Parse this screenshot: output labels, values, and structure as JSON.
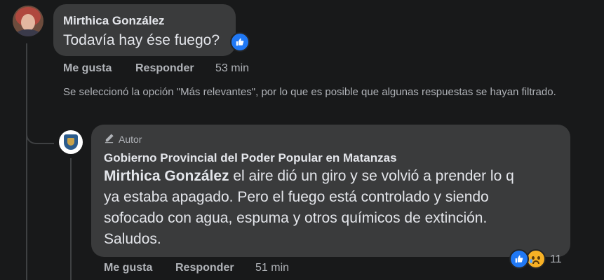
{
  "comment": {
    "author": "Mirthica González",
    "text": "Todavía hay ése fuego?",
    "actions": {
      "like": "Me gusta",
      "reply": "Responder"
    },
    "time": "53 min"
  },
  "notice": "Se seleccionó la opción \"Más relevantes\", por lo que es posible que algunas respuestas se hayan filtrado.",
  "reply": {
    "badge": "Autor",
    "author": "Gobierno Provincial del Poder Popular en Matanzas",
    "mention": "Mirthica González",
    "text_lines": [
      " el aire dió un giro y se volvió a prender lo q",
      "ya estaba apagado. Pero el fuego está controlado y siendo",
      "sofocado con agua, espuma y otros químicos de extinción.",
      "Saludos."
    ],
    "actions": {
      "like": "Me gusta",
      "reply": "Responder"
    },
    "time": "51 min",
    "reaction_count": "11"
  },
  "colors": {
    "background": "#18191a",
    "bubble": "#3a3b3c",
    "like_blue": "#2078f4",
    "sad_yellow": "#f7b125"
  },
  "icons": [
    "like-icon",
    "sad-icon",
    "pencil-icon"
  ]
}
